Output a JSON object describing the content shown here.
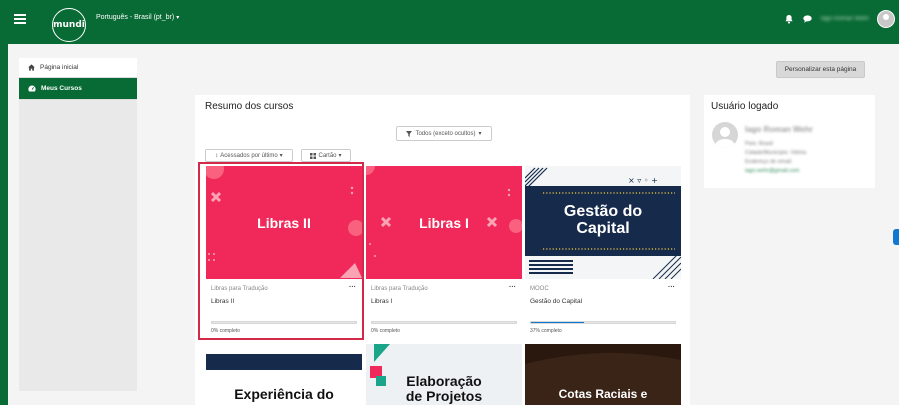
{
  "header": {
    "logo_text": "mundi",
    "language": "Português - Brasil (pt_br)",
    "user_name": "Iago Roman Wehr"
  },
  "nav": {
    "items": [
      {
        "label": "Página inicial",
        "icon": "home-icon"
      },
      {
        "label": "Meus Cursos",
        "icon": "dashboard-icon",
        "active": true
      }
    ]
  },
  "customize_button": "Personalizar esta página",
  "courses": {
    "title": "Resumo dos cursos",
    "filter": "Todos (exceto ocultos)",
    "sort": "Acessados por último",
    "view": "Cartão",
    "cards": [
      {
        "category": "Libras para Tradução",
        "name": "Libras II",
        "image_title": "Libras II",
        "progress_label": "0% completo",
        "progress": 0
      },
      {
        "category": "Libras para Tradução",
        "name": "Libras I",
        "image_title": "Libras I",
        "progress_label": "0% completo",
        "progress": 0
      },
      {
        "category": "MOOC",
        "name": "Gestão do Capital",
        "image_title_1": "Gestão do",
        "image_title_2": "Capital",
        "progress_label": "37% completo",
        "progress": 37
      }
    ],
    "row2": [
      {
        "image_title": "Experiência do"
      },
      {
        "image_title_1": "Elaboração",
        "image_title_2": "de Projetos"
      },
      {
        "image_title": "Cotas Raciais e"
      }
    ]
  },
  "logged_user": {
    "title": "Usuário logado",
    "name": "Iago Roman Wehr",
    "lines": [
      "País: Brasil",
      "Cidade/Município: Vitória",
      "Endereço de email:",
      "iago.wehr@gmail.com"
    ]
  },
  "colors": {
    "brand": "#086a34",
    "card_pink": "#f0295a",
    "navy": "#162b4b",
    "progress": "#1177d1"
  }
}
